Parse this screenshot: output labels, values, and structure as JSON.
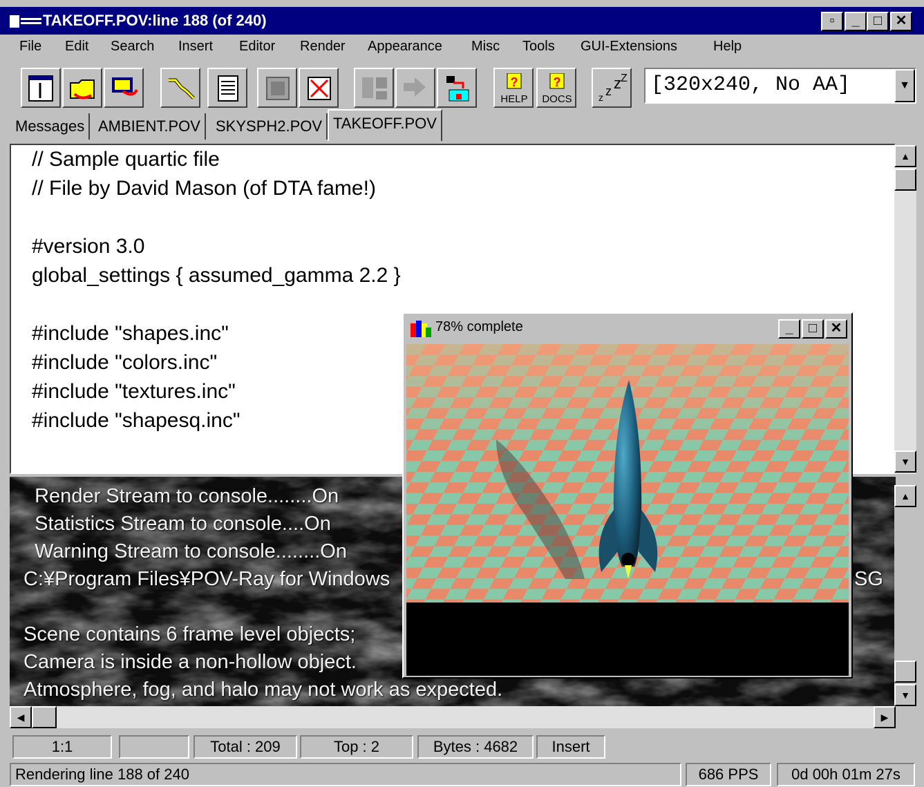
{
  "window": {
    "title": "TAKEOFF.POV:line 188 (of 240)",
    "restore_label": "▫",
    "minimize_label": "_",
    "maximize_label": "□",
    "close_label": "✕"
  },
  "menu": [
    "File",
    "Edit",
    "Search",
    "Insert",
    "Editor",
    "Render",
    "Appearance",
    "Misc",
    "Tools",
    "GUI-Extensions",
    "Help"
  ],
  "toolbar": {
    "help_label": "HELP",
    "docs_label": "DOCS",
    "render_settings": "[320x240, No AA]"
  },
  "tabs": [
    "Messages",
    "AMBIENT.POV",
    "SKYSPH2.POV",
    "TAKEOFF.POV"
  ],
  "editor_lines": [
    "// Sample quartic file",
    "// File by David Mason (of DTA fame!)",
    "",
    "#version 3.0",
    "global_settings { assumed_gamma 2.2 }",
    "",
    "#include \"shapes.inc\"",
    "#include \"colors.inc\"",
    "#include \"textures.inc\"",
    "#include \"shapesq.inc\""
  ],
  "console_lines": [
    "  Render Stream to console........On",
    "  Statistics Stream to console....On",
    "  Warning Stream to console........On",
    "C:¥Program Files¥POV-Ray for Windows",
    "",
    "Scene contains 6 frame level objects;",
    "Camera is inside a non-hollow object.",
    "Atmosphere, fog, and halo may not work as expected."
  ],
  "console_right_fragment": "SG",
  "render_window": {
    "title": "78% complete",
    "progress": 78
  },
  "status1": {
    "position": "1:1",
    "blank": "",
    "total": "Total : 209",
    "top": "Top : 2",
    "bytes": "Bytes : 4682",
    "mode": "Insert"
  },
  "status2": {
    "message": "Rendering line  188  of  240",
    "pps": "686 PPS",
    "elapsed": "0d 00h 01m 27s"
  }
}
